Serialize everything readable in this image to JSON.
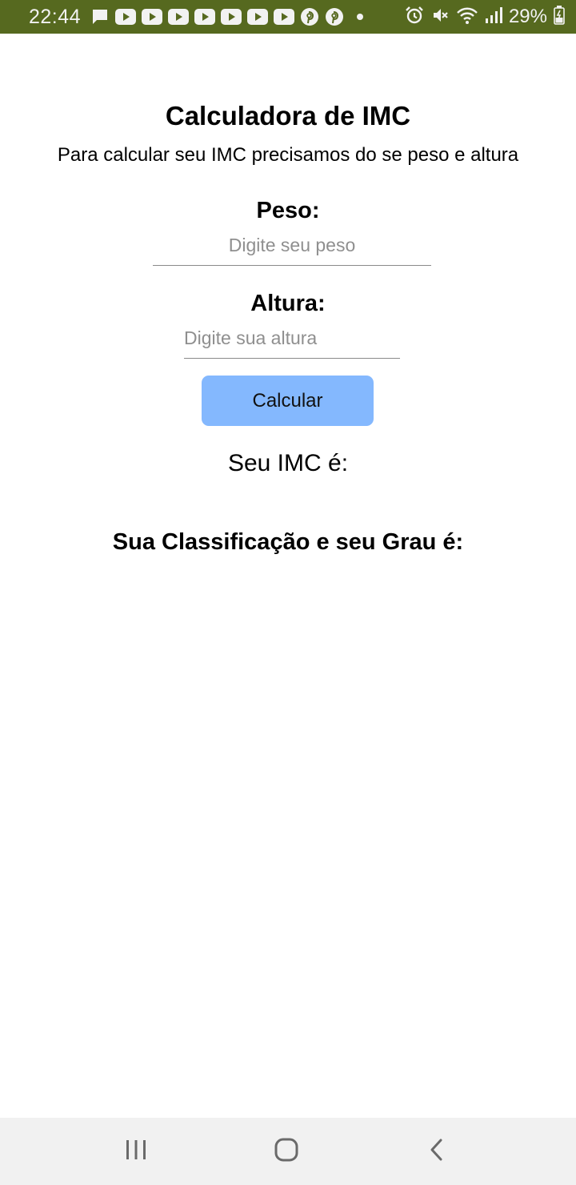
{
  "status_bar": {
    "time": "22:44",
    "battery_percent": "29%",
    "background_color": "#56691f",
    "notification_icons": [
      "message-icon",
      "youtube-icon",
      "youtube-icon",
      "youtube-icon",
      "youtube-icon",
      "youtube-icon",
      "youtube-icon",
      "youtube-icon",
      "pinterest-icon",
      "pinterest-icon",
      "dot-icon"
    ],
    "system_icons": [
      "alarm-icon",
      "mute-icon",
      "wifi-icon",
      "signal-icon",
      "battery-charging-icon"
    ]
  },
  "app": {
    "title": "Calculadora de IMC",
    "subtitle": "Para calcular seu IMC precisamos do se peso e altura",
    "weight_label": "Peso:",
    "weight_placeholder": "Digite seu peso",
    "height_label": "Altura:",
    "height_placeholder": "Digite sua altura",
    "calculate_button": "Calcular",
    "button_color": "#84b8fe",
    "imc_result_label": "Seu IMC é:",
    "classification_label": "Sua Classificação e seu Grau é:"
  },
  "nav_bar": {
    "buttons": [
      "recent-apps-icon",
      "home-icon",
      "back-icon"
    ]
  }
}
